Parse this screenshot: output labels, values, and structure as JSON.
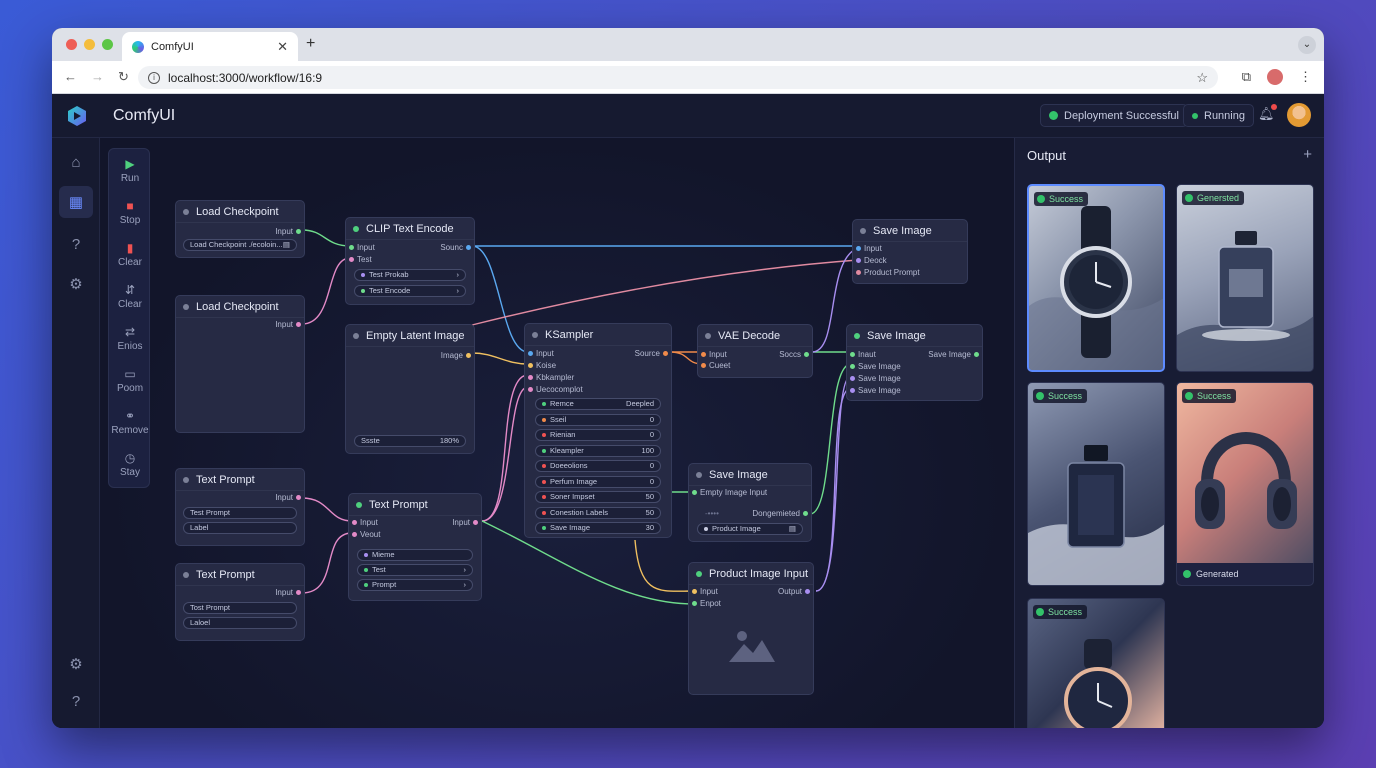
{
  "browser": {
    "tab_title": "ComfyUI",
    "url": "localhost:3000/workflow/16:9"
  },
  "app": {
    "title": "ComfyUI",
    "deploy_status": "Deployment Successful",
    "run_status": "Running"
  },
  "toolbar": {
    "run": "Run",
    "stop": "Stop",
    "clear1": "Clear",
    "clear2": "Clear",
    "enos": "Enios",
    "room": "Poom",
    "remove": "Remove",
    "stay": "Stay"
  },
  "nodes": {
    "load1": {
      "title": "Load Checkpoint",
      "port_out": "Input",
      "field": "Load Checkpoint ./ecoloin..."
    },
    "load2": {
      "title": "Load Checkpoint",
      "port_out": "Input"
    },
    "clip": {
      "title": "CLIP Text Encode",
      "in1": "Input",
      "in2": "Test",
      "out": "Sounc",
      "f1": "Test Prokab",
      "f2": "Test Encode"
    },
    "latent": {
      "title": "Empty Latent Image",
      "out": "Image",
      "f_label": "Ssste",
      "f_value": "180%"
    },
    "ksampler": {
      "title": "KSampler",
      "in1": "Input",
      "in2": "Koise",
      "in3": "Kbkampler",
      "in4": "Uecocomplot",
      "out": "Source",
      "fields": [
        {
          "label": "Remce",
          "value": "Deepled"
        },
        {
          "label": "Sseil",
          "value": "0"
        },
        {
          "label": "Rienian",
          "value": "0"
        },
        {
          "label": "Kleampler",
          "value": "100"
        },
        {
          "label": "Doeeolions",
          "value": "0"
        },
        {
          "label": "Perfum Image",
          "value": "0"
        },
        {
          "label": "Soner Impset",
          "value": "50"
        },
        {
          "label": "Conestion Labels",
          "value": "50"
        },
        {
          "label": "Save Image",
          "value": "30"
        }
      ]
    },
    "vae": {
      "title": "VAE Decode",
      "in1": "Input",
      "in2": "Cueet",
      "out": "Soccs"
    },
    "save_top": {
      "title": "Save Image",
      "in1": "Input",
      "in2": "Deock",
      "in3": "Product Prompt"
    },
    "save_mid": {
      "title": "Save Image",
      "in1": "Inaut",
      "in2": "Save Image",
      "in3": "Save Image",
      "in4": "Save Image",
      "out": "Save Image"
    },
    "tp1": {
      "title": "Text Prompt",
      "out": "Input",
      "f1": "Test Prompt",
      "f2": "Label"
    },
    "tp2": {
      "title": "Text Prompt",
      "out": "Input",
      "f1": "Tost Prompt",
      "f2": "Laloel"
    },
    "tpmid": {
      "title": "Text Prompt",
      "in1": "Input",
      "in2": "Veout",
      "out": "Input",
      "f1": "Mieme",
      "f2": "Test",
      "f3": "Prompt"
    },
    "save_low": {
      "title": "Save Image",
      "in1": "Empty Image Input",
      "field_label": "Dongemieted",
      "field_small": "-••••",
      "f2": "Product Image"
    },
    "product": {
      "title": "Product Image Input",
      "in1": "Input",
      "in2": "Enpot",
      "out": "Output"
    }
  },
  "output": {
    "title": "Output",
    "items": [
      {
        "tag": "Success",
        "subject": "watch-icon",
        "selected": true
      },
      {
        "tag": "Genersted",
        "subject": "perfume-icon",
        "selected": false
      },
      {
        "tag": "Success",
        "subject": "perfume-icon",
        "selected": false
      },
      {
        "tag": "Success",
        "subject": "headphones-icon",
        "selected": false,
        "footer": "Generated"
      },
      {
        "tag": "Success",
        "subject": "watch-icon",
        "selected": false
      }
    ]
  },
  "colors": {
    "accent": "#5d8bff",
    "success": "#33c26a",
    "wire_blue": "#5aa8f0",
    "wire_pink": "#e38ac7",
    "wire_green": "#6fdc8c",
    "wire_yellow": "#f0c060",
    "wire_orange": "#f08a4a",
    "wire_purple": "#a88ef0"
  }
}
